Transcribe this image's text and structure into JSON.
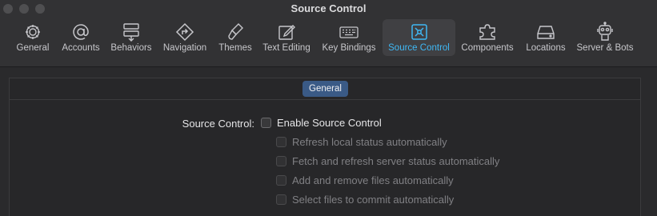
{
  "window": {
    "title": "Source Control"
  },
  "tabs": [
    {
      "label": "General",
      "icon": "gear-icon"
    },
    {
      "label": "Accounts",
      "icon": "at-sign-icon"
    },
    {
      "label": "Behaviors",
      "icon": "behaviors-icon"
    },
    {
      "label": "Navigation",
      "icon": "navigation-arrow-icon"
    },
    {
      "label": "Themes",
      "icon": "paintbrush-icon"
    },
    {
      "label": "Text Editing",
      "icon": "pencil-editor-icon"
    },
    {
      "label": "Key Bindings",
      "icon": "keyboard-icon"
    },
    {
      "label": "Source Control",
      "icon": "source-control-icon"
    },
    {
      "label": "Components",
      "icon": "puzzle-icon"
    },
    {
      "label": "Locations",
      "icon": "drive-icon"
    },
    {
      "label": "Server & Bots",
      "icon": "robot-icon"
    }
  ],
  "active_tab": "Source Control",
  "accent_color": "#3fb8f5",
  "segment": {
    "label": "General"
  },
  "source_control": {
    "label": "Source Control:",
    "enable": {
      "label": "Enable Source Control",
      "checked": false
    },
    "options": [
      {
        "label": "Refresh local status automatically",
        "checked": false
      },
      {
        "label": "Fetch and refresh server status automatically",
        "checked": false
      },
      {
        "label": "Add and remove files automatically",
        "checked": false
      },
      {
        "label": "Select files to commit automatically",
        "checked": false
      }
    ]
  }
}
